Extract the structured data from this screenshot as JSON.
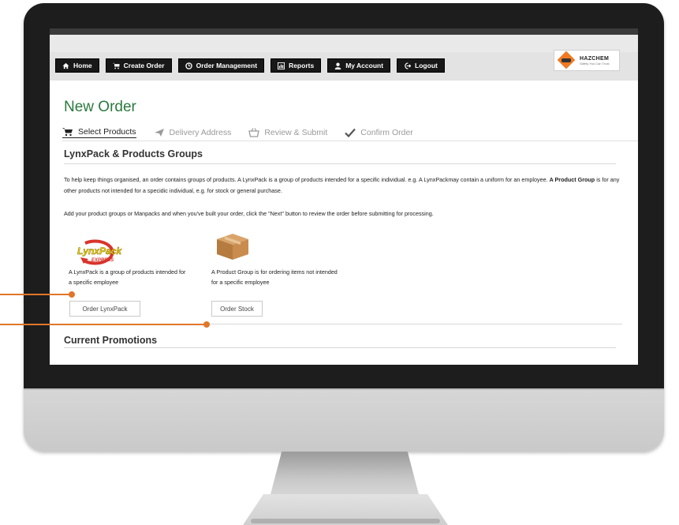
{
  "nav": {
    "items": [
      {
        "label": "Home",
        "icon": "home-icon"
      },
      {
        "label": "Create Order",
        "icon": "cart-icon"
      },
      {
        "label": "Order Management",
        "icon": "gear-icon"
      },
      {
        "label": "Reports",
        "icon": "report-icon"
      },
      {
        "label": "My Account",
        "icon": "user-icon"
      },
      {
        "label": "Logout",
        "icon": "logout-icon"
      }
    ]
  },
  "logo": {
    "name": "HAZCHEM",
    "tagline": "Safety You Can Trust"
  },
  "page": {
    "title": "New Order"
  },
  "steps": [
    {
      "label": "Select Products",
      "icon": "cart-icon",
      "active": true
    },
    {
      "label": "Delivery Address",
      "icon": "send-icon",
      "active": false
    },
    {
      "label": "Review & Submit",
      "icon": "basket-icon",
      "active": false
    },
    {
      "label": "Confirm Order",
      "icon": "check-icon",
      "active": false
    }
  ],
  "section": {
    "heading": "LynxPack & Products Groups",
    "intro_part1": "To help keep things organised, an order contains groups of products. A LynxPack is a group of products intended for a specific individual. e.g. A LynxPackmay contain a uniform for an employee. ",
    "intro_bold": "A Product Group",
    "intro_part2": " is for any other products not intended for a specidic individual, e.g. for stock or general purchase.",
    "intro2": "Add your product groups or Manpacks and when you've built your order, click the \"Next\" button to review the order before submitting for processing."
  },
  "lynxpack": {
    "logo_text": "LynxPack",
    "logo_sub": "EXPRESS",
    "description": "A LynxPack is a group of products intended for a specific employee",
    "button": "Order LynxPack"
  },
  "stock": {
    "description": "A Product Group is for ordering items not intended for a specific employee",
    "button": "Order Stock"
  },
  "promotions": {
    "heading": "Current Promotions"
  },
  "colors": {
    "accent_green": "#2a7a3d",
    "callout_orange": "#e0762a",
    "nav_black": "#181818"
  }
}
